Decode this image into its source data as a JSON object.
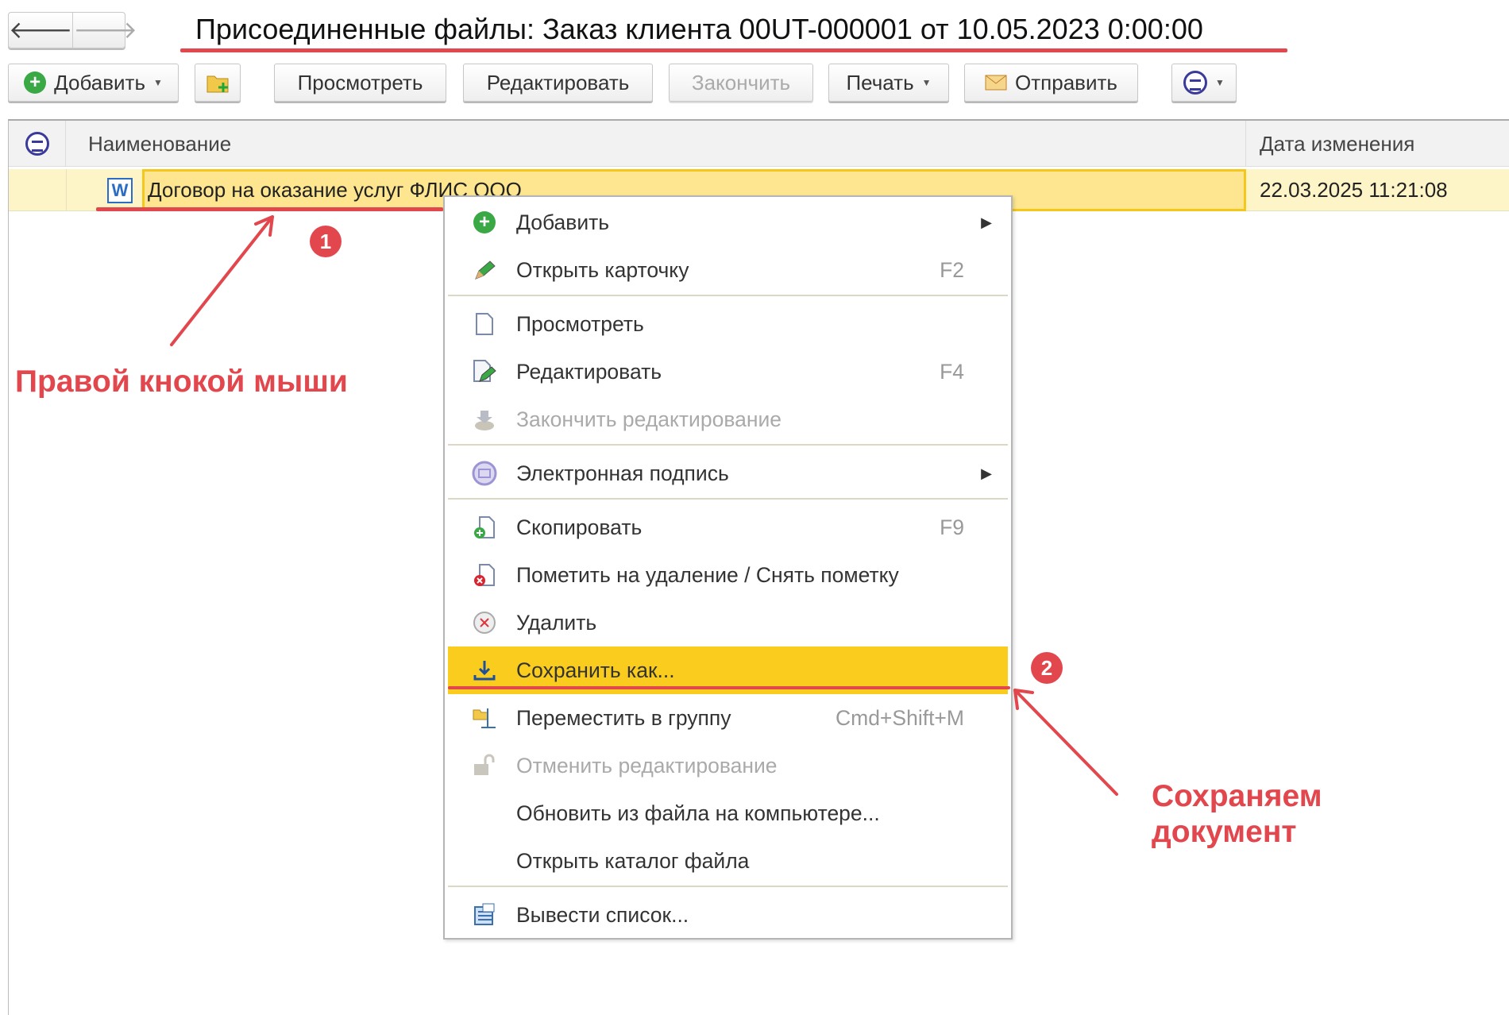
{
  "window": {
    "title": "Присоединенные файлы: Заказ клиента 00UT-000001 от 10.05.2023 0:00:00"
  },
  "nav": {
    "back": "🡐",
    "forward": "🡒"
  },
  "toolbar": {
    "add": "Добавить",
    "view": "Просмотреть",
    "edit": "Редактировать",
    "finish": "Закончить",
    "print": "Печать",
    "send": "Отправить"
  },
  "table": {
    "columns": {
      "name": "Наименование",
      "modified": "Дата изменения"
    },
    "rows": [
      {
        "name": "Договор на оказание услуг ФЛИС ООО",
        "modified": "22.03.2025 11:21:08",
        "icon": "word-file-icon"
      }
    ]
  },
  "context_menu": {
    "items": [
      {
        "label": "Добавить",
        "icon": "add-icon",
        "submenu": true
      },
      {
        "label": "Открыть карточку",
        "icon": "pencil-icon",
        "shortcut": "F2"
      },
      {
        "label": "Просмотреть",
        "icon": "document-icon"
      },
      {
        "label": "Редактировать",
        "icon": "edit-document-icon",
        "shortcut": "F4"
      },
      {
        "label": "Закончить редактирование",
        "icon": "finish-editing-icon",
        "disabled": true
      },
      {
        "label": "Электронная подпись",
        "icon": "digital-signature-icon",
        "submenu": true
      },
      {
        "label": "Скопировать",
        "icon": "copy-icon",
        "shortcut": "F9"
      },
      {
        "label": "Пометить на удаление / Снять пометку",
        "icon": "mark-delete-icon"
      },
      {
        "label": "Удалить",
        "icon": "delete-icon"
      },
      {
        "label": "Сохранить как...",
        "icon": "download-icon",
        "highlighted": true
      },
      {
        "label": "Переместить в группу",
        "icon": "move-to-group-icon",
        "shortcut": "Cmd+Shift+M"
      },
      {
        "label": "Отменить редактирование",
        "icon": "unlock-icon",
        "disabled": true
      },
      {
        "label": "Обновить из файла на компьютере...",
        "icon": ""
      },
      {
        "label": "Открыть каталог файла",
        "icon": ""
      },
      {
        "label": "Вывести список...",
        "icon": "output-list-icon"
      }
    ]
  },
  "annotations": {
    "badge1": "1",
    "badge2": "2",
    "note1": "Правой кнокой мыши",
    "note2_line1": "Сохраняем",
    "note2_line2": "документ",
    "color": "#e2474d"
  },
  "colors": {
    "selection": "#fde68f",
    "menu_highlight": "#f9cc1d"
  }
}
